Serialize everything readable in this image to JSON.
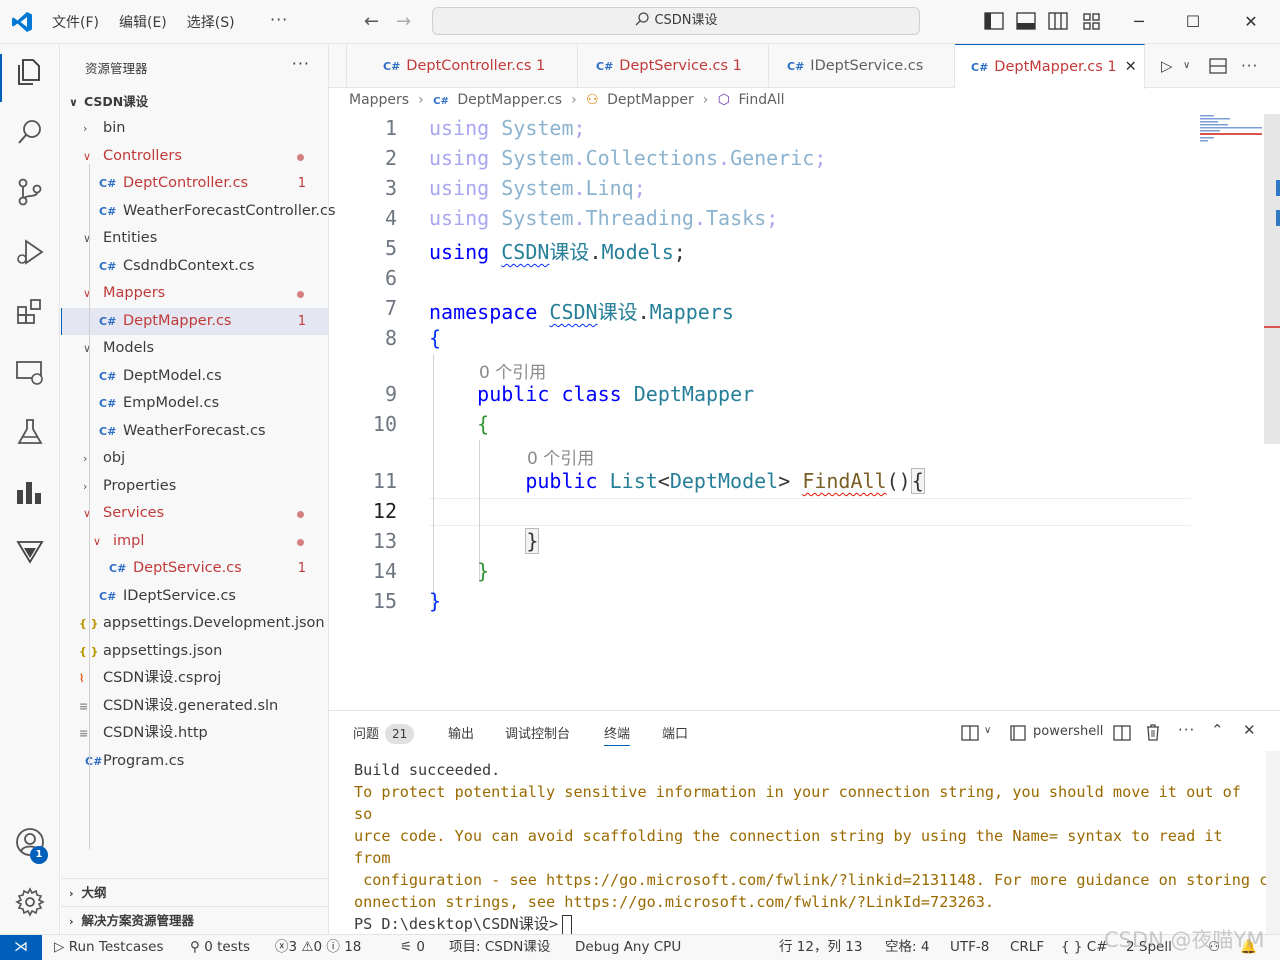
{
  "titlebar": {
    "menus": [
      "文件(F)",
      "编辑(E)",
      "选择(S)"
    ],
    "more": "···",
    "search_text": "CSDN课设"
  },
  "explorer": {
    "title": "资源管理器",
    "more": "···",
    "root": "CSDN课设",
    "items": [
      {
        "label": "bin",
        "kind": "folder",
        "indent": 0,
        "expanded": false
      },
      {
        "label": "Controllers",
        "kind": "folder",
        "indent": 0,
        "expanded": true,
        "error": true,
        "dot": true
      },
      {
        "label": "DeptController.cs",
        "kind": "cs",
        "indent": 1,
        "error": true,
        "count": "1"
      },
      {
        "label": "WeatherForecastController.cs",
        "kind": "cs",
        "indent": 1
      },
      {
        "label": "Entities",
        "kind": "folder",
        "indent": 0,
        "expanded": true
      },
      {
        "label": "CsdndbContext.cs",
        "kind": "cs",
        "indent": 1
      },
      {
        "label": "Mappers",
        "kind": "folder",
        "indent": 0,
        "expanded": true,
        "error": true,
        "dot": true
      },
      {
        "label": "DeptMapper.cs",
        "kind": "cs",
        "indent": 1,
        "error": true,
        "count": "1",
        "selected": true
      },
      {
        "label": "Models",
        "kind": "folder",
        "indent": 0,
        "expanded": true
      },
      {
        "label": "DeptModel.cs",
        "kind": "cs",
        "indent": 1
      },
      {
        "label": "EmpModel.cs",
        "kind": "cs",
        "indent": 1
      },
      {
        "label": "WeatherForecast.cs",
        "kind": "cs",
        "indent": 1
      },
      {
        "label": "obj",
        "kind": "folder",
        "indent": 0,
        "expanded": false
      },
      {
        "label": "Properties",
        "kind": "folder",
        "indent": 0,
        "expanded": false
      },
      {
        "label": "Services",
        "kind": "folder",
        "indent": 0,
        "expanded": true,
        "error": true,
        "dot": true
      },
      {
        "label": "impl",
        "kind": "folder",
        "indent": 1,
        "expanded": true,
        "error": true,
        "dot": true
      },
      {
        "label": "DeptService.cs",
        "kind": "cs",
        "indent": 2,
        "error": true,
        "count": "1"
      },
      {
        "label": "IDeptService.cs",
        "kind": "cs",
        "indent": 1
      },
      {
        "label": "appsettings.Development.json",
        "kind": "json",
        "indent": 0
      },
      {
        "label": "appsettings.json",
        "kind": "json",
        "indent": 0
      },
      {
        "label": "CSDN课设.csproj",
        "kind": "rss",
        "indent": 0
      },
      {
        "label": "CSDN课设.generated.sln",
        "kind": "txt",
        "indent": 0
      },
      {
        "label": "CSDN课设.http",
        "kind": "txt",
        "indent": 0
      },
      {
        "label": "Program.cs",
        "kind": "cs",
        "indent": 0
      }
    ],
    "sections": [
      "大纲",
      "解决方案资源管理器"
    ]
  },
  "tabs": [
    {
      "label": "DeptController.cs",
      "count": "1",
      "error": true
    },
    {
      "label": "DeptService.cs",
      "count": "1",
      "error": true
    },
    {
      "label": "IDeptService.cs",
      "count": "",
      "error": false
    },
    {
      "label": "DeptMapper.cs",
      "count": "1",
      "error": true,
      "active": true
    }
  ],
  "breadcrumb": [
    "Mappers",
    "DeptMapper.cs",
    "DeptMapper",
    "FindAll"
  ],
  "editor": {
    "line_numbers": [
      "1",
      "2",
      "3",
      "4",
      "5",
      "6",
      "7",
      "8",
      "9",
      "10",
      "11",
      "12",
      "13",
      "14",
      "15"
    ],
    "current_line": "12",
    "codelens": "0 个引用"
  },
  "panel": {
    "tabs": [
      "问题",
      "输出",
      "调试控制台",
      "终端",
      "端口"
    ],
    "problems_count": "21",
    "active_tab": "终端",
    "shell": "powershell",
    "terminal_lines": [
      "Build succeeded.",
      "To protect potentially sensitive information in your connection string, you should move it out of so",
      "urce code. You can avoid scaffolding the connection string by using the Name= syntax to read it from",
      " configuration - see https://go.microsoft.com/fwlink/?linkid=2131148. For more guidance on storing c",
      "onnection strings, see https://go.microsoft.com/fwlink/?LinkId=723263."
    ],
    "prompt": "PS D:\\desktop\\CSDN课设>"
  },
  "statusbar": {
    "run": "Run Testcases",
    "tests": "0 tests",
    "errors": "3",
    "warnings": "0",
    "infos": "18",
    "ports": "0",
    "project": "项目: CSDN课设",
    "config": "Debug Any CPU",
    "position": "行 12，列 13",
    "spaces": "空格: 4",
    "encoding": "UTF-8",
    "eol": "CRLF",
    "lang": "C#",
    "spell": "2 Spell"
  },
  "watermark": "CSDN @夜喵YM",
  "colors": {
    "accent": "#005fb8",
    "error": "#c13a3a",
    "keyword": "#0000ff",
    "type": "#267f99"
  }
}
